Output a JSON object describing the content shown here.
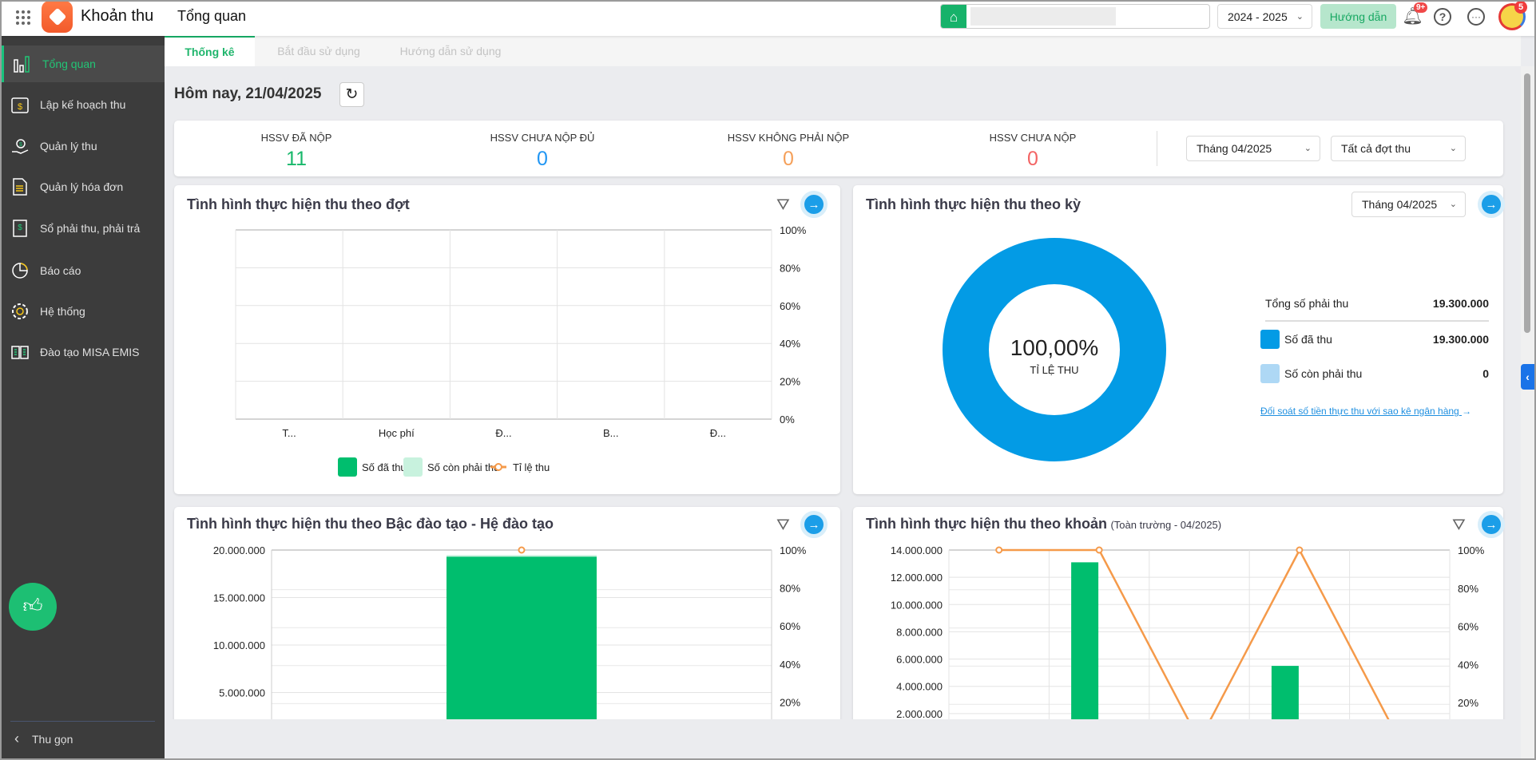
{
  "header": {
    "app_name": "Khoản thu",
    "page_title": "Tổng quan",
    "search_placeholder": "",
    "year": "2024 - 2025",
    "guide_button": "Hướng dẫn",
    "notification_badge": "9+",
    "avatar_badge": "5",
    "accent": "#17b26a"
  },
  "sidebar": {
    "items": [
      {
        "label": "Tổng quan",
        "icon": "bar-chart-icon",
        "active": true
      },
      {
        "label": "Lập kế hoạch thu",
        "icon": "calendar-dollar-icon"
      },
      {
        "label": "Quản lý thu",
        "icon": "hand-coin-icon"
      },
      {
        "label": "Quản lý hóa đơn",
        "icon": "document-icon"
      },
      {
        "label": "Sổ phải thu, phải trả",
        "icon": "ledger-book-icon"
      },
      {
        "label": "Báo cáo",
        "icon": "pie-chart-icon"
      },
      {
        "label": "Hệ thống",
        "icon": "gear-icon"
      },
      {
        "label": "Đào tạo MISA EMIS",
        "icon": "open-book-icon"
      }
    ],
    "collapse_label": "Thu gọn"
  },
  "tabs": [
    {
      "label": "Thống kê",
      "active": true
    },
    {
      "label": "Bắt đầu sử dụng"
    },
    {
      "label": "Hướng dẫn sử dụng"
    }
  ],
  "today": "Hôm nay, 21/04/2025",
  "stats": [
    {
      "label": "HSSV ĐÃ NỘP",
      "value": "11",
      "color": "#19b86b"
    },
    {
      "label": "HSSV CHƯA NỘP ĐỦ",
      "value": "0",
      "color": "#2196f3"
    },
    {
      "label": "HSSV KHÔNG PHẢI NỘP",
      "value": "0",
      "color": "#f5a05a"
    },
    {
      "label": "HSSV CHƯA NỘP",
      "value": "0",
      "color": "#f36464"
    }
  ],
  "filters": {
    "month": "Tháng 04/2025",
    "batch": "Tất cả đợt thu"
  },
  "card_dot": {
    "title": "Tình hình thực hiện thu theo đợt"
  },
  "card_ky": {
    "title": "Tình hình thực hiện thu theo kỳ",
    "month": "Tháng 04/2025",
    "center_value": "100,00%",
    "center_label": "TỈ LỆ THU",
    "total_label": "Tổng số phải thu",
    "total_value": "19.300.000",
    "legend": [
      {
        "label": "Số đã thu",
        "value": "19.300.000",
        "color": "#039be5"
      },
      {
        "label": "Số còn phải thu",
        "value": "0",
        "color": "#aed8f5"
      }
    ],
    "link": "Đối soát số tiền thực thu với sao kê ngân hàng"
  },
  "card_bac": {
    "title": "Tình hình thực hiện thu theo Bậc đào tạo - Hệ đào tạo"
  },
  "card_khoan": {
    "title": "Tình hình thực hiện thu theo khoản",
    "subtitle": "(Toàn trường - 04/2025)"
  },
  "chart_data": [
    {
      "type": "bar",
      "categories": [
        "T...",
        "Học phí",
        "Đ...",
        "B...",
        "Đ..."
      ],
      "series": [
        {
          "name": "Số đã thu",
          "values": [
            0,
            0,
            0,
            0,
            0
          ],
          "color": "#00be6e"
        },
        {
          "name": "Số còn phải thu",
          "values": [
            0,
            0,
            0,
            0,
            0
          ],
          "color": "#c8f2de"
        },
        {
          "name": "Tỉ lệ thu",
          "type": "line",
          "values": [
            null,
            null,
            null,
            null,
            null
          ],
          "color": "#f59a4a"
        }
      ],
      "y2_ticks": [
        "100%",
        "80%",
        "60%",
        "40%",
        "20%",
        "0%"
      ],
      "y2lim": [
        0,
        100
      ],
      "grid": true,
      "legend": "bottom"
    },
    {
      "type": "pie",
      "values": [
        19300000,
        0
      ],
      "labels": [
        "Số đã thu",
        "Số còn phải thu"
      ]
    },
    {
      "type": "bar",
      "categories": [
        ""
      ],
      "series": [
        {
          "name": "Số đã thu",
          "values": [
            19300000
          ]
        },
        {
          "name": "Số còn phải thu",
          "values": [
            0
          ]
        },
        {
          "name": "Tỉ lệ thu",
          "type": "line",
          "values": [
            100
          ]
        }
      ],
      "y_ticks": [
        "20.000.000",
        "15.000.000",
        "10.000.000",
        "5.000.000"
      ],
      "ylim": [
        0,
        20000000
      ],
      "y2_ticks": [
        "100%",
        "80%",
        "60%",
        "40%",
        "20%"
      ],
      "y2lim": [
        0,
        100
      ],
      "grid": true
    },
    {
      "type": "bar",
      "categories": [
        "",
        "",
        "",
        "",
        ""
      ],
      "series": [
        {
          "name": "Số đã thu",
          "values": [
            0,
            13100000,
            0,
            5500000,
            0
          ]
        },
        {
          "name": "Tỉ lệ thu",
          "type": "line",
          "values": [
            100,
            100,
            0,
            100,
            0
          ]
        }
      ],
      "y_ticks": [
        "14.000.000",
        "12.000.000",
        "10.000.000",
        "8.000.000",
        "6.000.000",
        "4.000.000",
        "2.000.000"
      ],
      "ylim": [
        0,
        14000000
      ],
      "y2_ticks": [
        "100%",
        "80%",
        "60%",
        "40%",
        "20%"
      ],
      "y2lim": [
        0,
        100
      ],
      "grid": true
    }
  ]
}
